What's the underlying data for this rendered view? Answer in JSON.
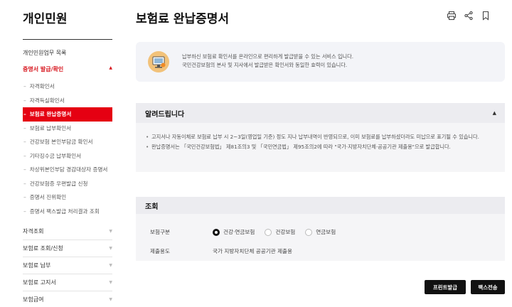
{
  "sidebar": {
    "title": "개인민원",
    "section_heading": "개인민원업무 목록",
    "active_group": "증명서 발급/확인",
    "sub_items": [
      {
        "label": "자격확인서",
        "active": false
      },
      {
        "label": "자격득실확인서",
        "active": false
      },
      {
        "label": "보험료 완납증명서",
        "active": true
      },
      {
        "label": "보험료 납부확인서",
        "active": false
      },
      {
        "label": "건강보험 본인부담금 확인서",
        "active": false
      },
      {
        "label": "기타징수금 납부확인서",
        "active": false
      },
      {
        "label": "차상위본인부담 경감대상자 증명서",
        "active": false
      },
      {
        "label": "건강보험증 우편발급 신청",
        "active": false
      },
      {
        "label": "증명서 진위확인",
        "active": false
      },
      {
        "label": "증명서 팩스발급 처리결과 조회",
        "active": false
      }
    ],
    "groups": [
      "자격조회",
      "보험료 조회/신청",
      "보험료 납부",
      "보험료 고지서",
      "보험급여"
    ]
  },
  "page": {
    "title": "보험료 완납증명서",
    "icons": [
      "print-icon",
      "share-icon",
      "bookmark-icon"
    ]
  },
  "intro": {
    "line1": "납부하신 보험료 확인서를 온라인으로 편리하게 발급받을 수 있는 서비스 입니다.",
    "line2": "국민건강보험의 본사 및 지사에서 발급받은 확인서와 동일한 효력이 있습니다."
  },
  "notice": {
    "title": "알려드립니다",
    "items": [
      "고지서나 자동이체로 보험료 납부 시 2~3일(영업일 기준) 정도 지나 납부내역이 반영되므로, 이미 보험료를 납부하셨더라도 미납으로 표기될 수 있습니다.",
      "완납증명서는 「국민건강보험법」 제81조의3 및 「국민연금법」 제95조의2에 따라 \"국가·지방자치단체·공공기관 제출용\"으로 발급합니다."
    ]
  },
  "query": {
    "title": "조회",
    "type_label": "보험구분",
    "options": [
      {
        "label": "건강·연금보험",
        "checked": true
      },
      {
        "label": "건강보험",
        "checked": false
      },
      {
        "label": "연금보험",
        "checked": false
      }
    ],
    "purpose_label": "제출용도",
    "purpose_value": "국가 지방자치단체 공공기관 제출용"
  },
  "buttons": {
    "print": "프린트발급",
    "fax": "팩스전송"
  },
  "colors": {
    "accent": "#e50012",
    "dark_button": "#111111"
  }
}
